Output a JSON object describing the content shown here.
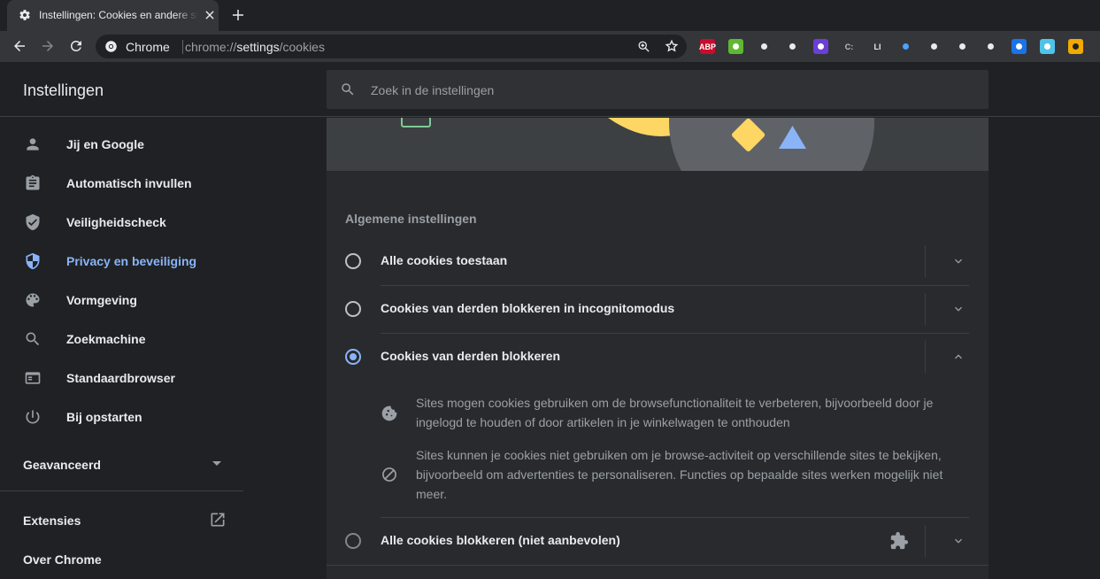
{
  "browser": {
    "tab_title": "Instellingen: Cookies en andere sitegegevens",
    "site_name": "Chrome",
    "url_scheme": "chrome://",
    "url_host": "settings",
    "url_path": "/cookies",
    "extensions": [
      {
        "name": "adblock-plus",
        "label": "ABP",
        "color": "#c70d2c",
        "text_color": "#ffffff"
      },
      {
        "name": "green-cube",
        "label": "",
        "color": "#5fb832",
        "text_color": "#ffffff"
      },
      {
        "name": "pen",
        "label": "",
        "color": "#35363a",
        "text_color": "#e8eaed"
      },
      {
        "name": "gear",
        "label": "",
        "color": "#35363a",
        "text_color": "#e8eaed"
      },
      {
        "name": "purple-diamond",
        "label": "",
        "color": "#6a3fd6",
        "text_color": "#ffffff"
      },
      {
        "name": "c-bracket",
        "label": "C:",
        "color": "#35363a",
        "text_color": "#bdc1c6"
      },
      {
        "name": "li",
        "label": "LI",
        "color": "#35363a",
        "text_color": "#e8eaed"
      },
      {
        "name": "bar-chart",
        "label": "",
        "color": "#35363a",
        "text_color": "#4aa3ff"
      },
      {
        "name": "react",
        "label": "",
        "color": "#35363a",
        "text_color": "#e8eaed"
      },
      {
        "name": "target",
        "label": "",
        "color": "#35363a",
        "text_color": "#e8eaed"
      },
      {
        "name": "eye-search",
        "label": "",
        "color": "#35363a",
        "text_color": "#e8eaed"
      },
      {
        "name": "blue-box",
        "label": "",
        "color": "#1a73e8",
        "text_color": "#ffffff"
      },
      {
        "name": "cyan-circle",
        "label": "",
        "color": "#4fc3e8",
        "text_color": "#ffffff"
      },
      {
        "name": "gold-box",
        "label": "",
        "color": "#f2a900",
        "text_color": "#202124"
      }
    ]
  },
  "header": {
    "title": "Instellingen",
    "search_placeholder": "Zoek in de instellingen"
  },
  "sidebar": {
    "items": [
      {
        "icon": "person-icon",
        "label": "Jij en Google",
        "active": false
      },
      {
        "icon": "assignment-icon",
        "label": "Automatisch invullen",
        "active": false
      },
      {
        "icon": "shield-check-icon",
        "label": "Veiligheidscheck",
        "active": false
      },
      {
        "icon": "shield-privacy-icon",
        "label": "Privacy en beveiliging",
        "active": true
      },
      {
        "icon": "palette-icon",
        "label": "Vormgeving",
        "active": false
      },
      {
        "icon": "search-icon",
        "label": "Zoekmachine",
        "active": false
      },
      {
        "icon": "browser-window-icon",
        "label": "Standaardbrowser",
        "active": false
      },
      {
        "icon": "power-icon",
        "label": "Bij opstarten",
        "active": false
      }
    ],
    "advanced_label": "Geavanceerd",
    "extensions_label": "Extensies",
    "about_label": "Over Chrome"
  },
  "main": {
    "section_title": "Algemene instellingen",
    "options": [
      {
        "label": "Alle cookies toestaan",
        "selected": false,
        "expanded": false
      },
      {
        "label": "Cookies van derden blokkeren in incognitomodus",
        "selected": false,
        "expanded": false
      },
      {
        "label": "Cookies van derden blokkeren",
        "selected": true,
        "expanded": true
      },
      {
        "label": "Alle cookies blokkeren (niet aanbevolen)",
        "selected": false,
        "expanded": false
      }
    ],
    "details": [
      {
        "icon": "cookie-icon",
        "text": "Sites mogen cookies gebruiken om de browsefunctionaliteit te verbeteren, bijvoorbeeld door je ingelogd te houden of door artikelen in je winkelwagen te onthouden"
      },
      {
        "icon": "block-icon",
        "text": "Sites kunnen je cookies niet gebruiken om je browse-activiteit op verschillende sites te bekijken, bijvoorbeeld om advertenties te personaliseren. Functies op bepaalde sites werken mogelijk niet meer."
      }
    ]
  },
  "colors": {
    "accent": "#8ab4f8",
    "background": "#202124",
    "card": "#292a2d",
    "banner_yellow": "#fdd663",
    "banner_blue": "#8ab4f8",
    "banner_green": "#81c995"
  }
}
